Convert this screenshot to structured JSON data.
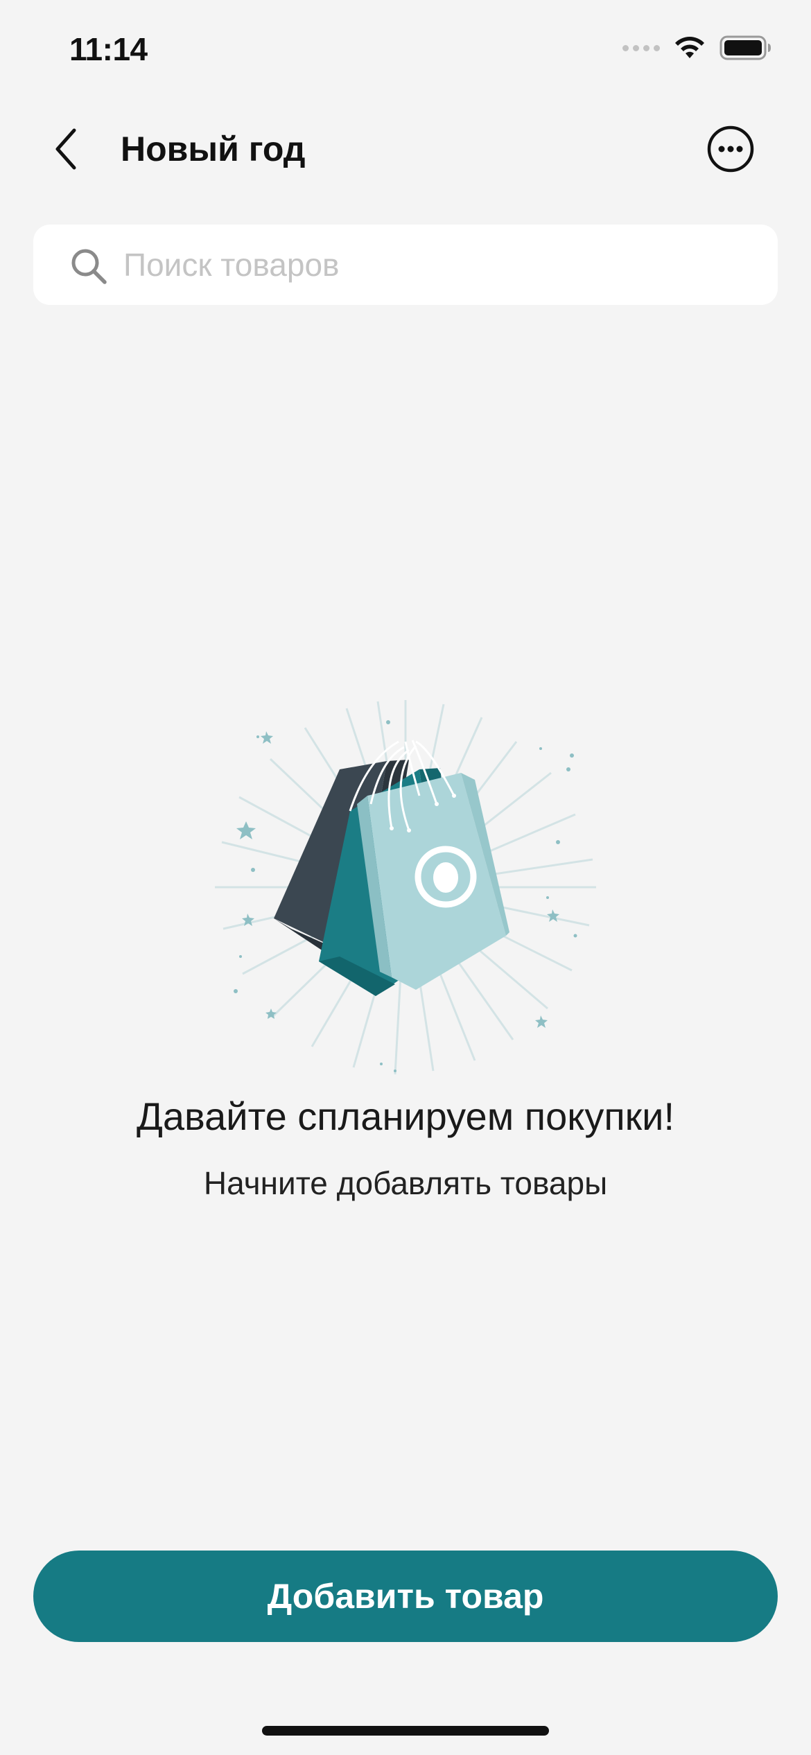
{
  "status_bar": {
    "time": "11:14",
    "icons": [
      "cellular-signal-icon",
      "wifi-icon",
      "battery-icon"
    ]
  },
  "nav": {
    "title": "Новый год",
    "back_icon": "chevron-left-icon",
    "more_icon": "ellipsis-circle-icon"
  },
  "search": {
    "placeholder": "Поиск товаров",
    "value": "",
    "icon": "search-icon"
  },
  "empty_state": {
    "illustration": "shopping-bags-illustration",
    "title": "Давайте спланируем покупки!",
    "subtitle": "Начните добавлять товары"
  },
  "footer": {
    "add_button_label": "Добавить товар"
  },
  "colors": {
    "background": "#f4f4f4",
    "accent": "#167b84",
    "bag_dark": "#3a4650",
    "bag_teal": "#1b7d85",
    "bag_light": "#a9d4d8",
    "placeholder": "#c4c4c4"
  }
}
